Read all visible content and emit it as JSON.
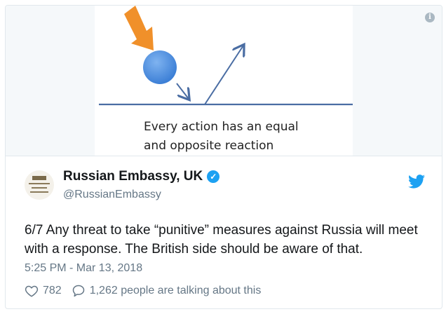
{
  "media": {
    "caption_line1": "Every action has an equal",
    "caption_line2": "and opposite reaction",
    "info_icon": "info-icon"
  },
  "tweet": {
    "display_name": "Russian Embassy, UK",
    "handle": "@RussianEmbassy",
    "text": "6/7 Any threat to take “punitive” measures against Russia will meet with a response. The British side should be aware of that.",
    "timestamp": "5:25 PM - Mar 13, 2018",
    "like_count": "782",
    "talk_text": "1,262 people are talking about this",
    "verified_icon": "verified-badge-icon",
    "brand_icon": "twitter-bird-icon"
  },
  "colors": {
    "accent": "#1da1f2",
    "arrow_orange": "#f0902a",
    "ball_blue": "#4a8fde",
    "line_blue": "#4a6da3"
  }
}
